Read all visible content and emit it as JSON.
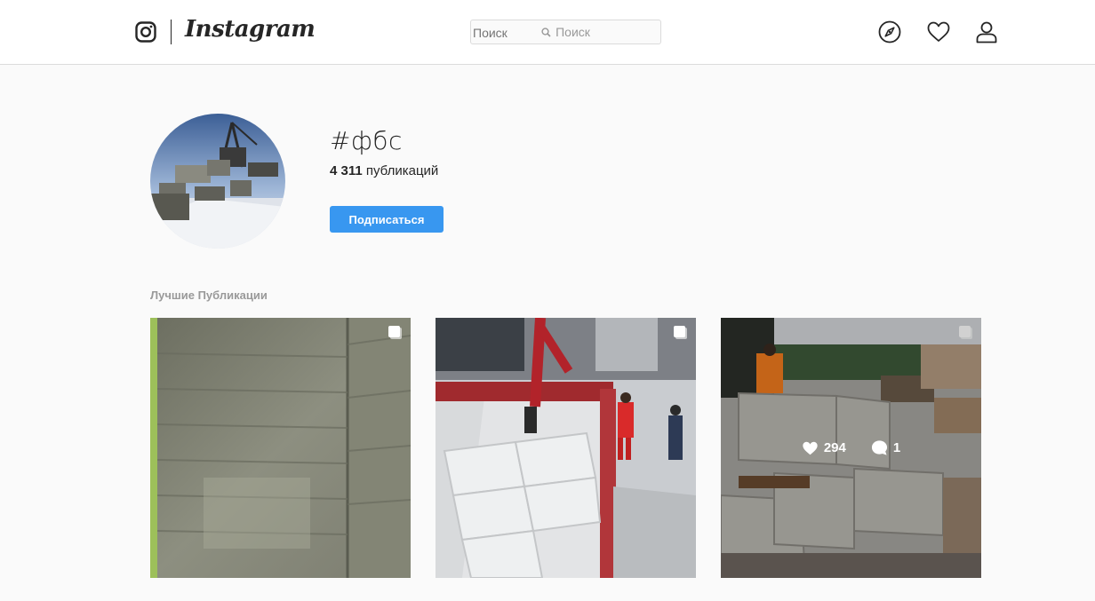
{
  "header": {
    "logo_text": "Instagram",
    "search": {
      "placeholder": "Поиск"
    },
    "nav_icons": [
      "compass-icon",
      "heart-icon",
      "profile-icon"
    ]
  },
  "profile": {
    "hashtag": "#фбс",
    "post_count": "4 311",
    "post_count_label": "публикаций",
    "follow_label": "Подписаться"
  },
  "top_posts": {
    "title": "Лучшие Публикации",
    "posts": [
      {
        "description": "concrete-wall",
        "multi": true
      },
      {
        "description": "crane-unloading-blocks",
        "multi": true
      },
      {
        "description": "concrete-blocks-site",
        "multi": true,
        "likes": "294",
        "comments": "1"
      }
    ]
  },
  "colors": {
    "accent": "#3897f0",
    "muted": "#999999",
    "border": "#dbdbdb",
    "background": "#fafafa"
  }
}
